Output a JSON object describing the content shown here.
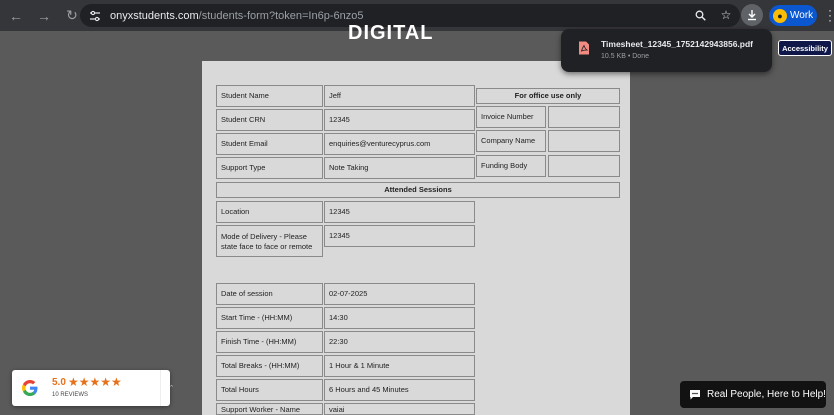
{
  "browser": {
    "url_host": "onyxstudents.com",
    "url_path": "/students-form?token=In6p-6nzo5",
    "profile_label": "Work"
  },
  "page": {
    "title": "DIGITAL FORM"
  },
  "form": {
    "student_name_label": "Student Name",
    "student_name_value": "Jeff",
    "student_crn_label": "Student CRN",
    "student_crn_value": "12345",
    "student_email_label": "Student Email",
    "student_email_value": "enquiries@venturecyprus.com",
    "support_type_label": "Support Type",
    "support_type_value": "Note Taking",
    "office_header": "For office use only",
    "invoice_number_label": "Invoice Number",
    "invoice_number_value": "",
    "company_name_label": "Company Name",
    "company_name_value": "",
    "funding_body_label": "Funding Body",
    "funding_body_value": "",
    "attended_header": "Attended Sessions",
    "location_label": "Location",
    "location_value": "12345",
    "mode_label": "Mode of Delivery - Please state face to face or remote",
    "mode_value": "12345",
    "date_label": "Date of session",
    "date_value": "02-07-2025",
    "start_label": "Start Time - (HH:MM)",
    "start_value": "14:30",
    "finish_label": "Finish Time - (HH:MM)",
    "finish_value": "22:30",
    "breaks_label": "Total Breaks - (HH:MM)",
    "breaks_value": "1 Hour & 1 Minute",
    "hours_label": "Total Hours",
    "hours_value": "6 Hours and 45 Minutes",
    "worker_label": "Support Worker - Name",
    "worker_value": "vaiai"
  },
  "download": {
    "filename": "Timesheet_12345_1752142943856.pdf",
    "meta": "10.5 KB • Done"
  },
  "accessibility_label": "Accessibility",
  "google_badge": {
    "rating": "5.0",
    "stars": "★★★★★",
    "reviews": "10 REVIEWS"
  },
  "chat": {
    "label": "Real People, Here to Help!"
  },
  "colors": {
    "accent": "#0b57d0",
    "star": "#e7711b",
    "page_bg": "#5a5a5a",
    "sheet_bg": "#d9d9d9"
  }
}
